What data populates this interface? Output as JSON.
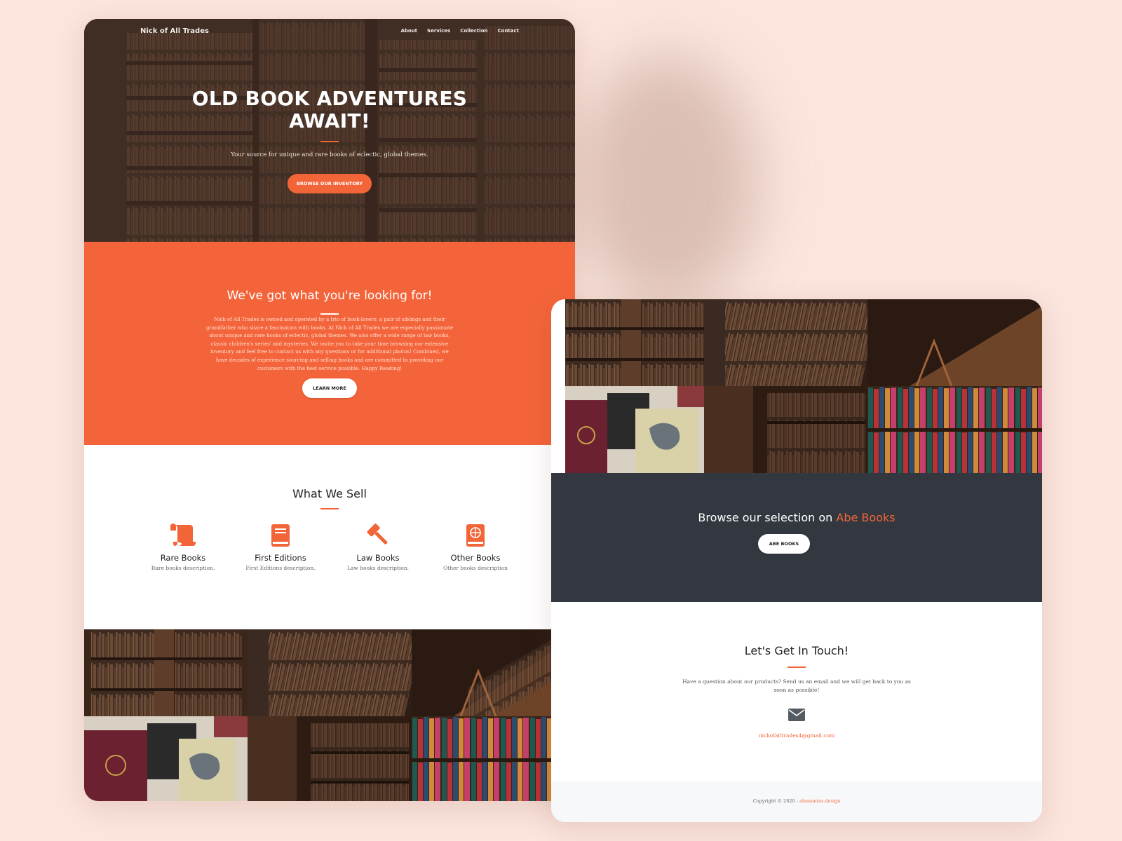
{
  "nav": {
    "brand": "Nick of All Trades",
    "links": [
      "About",
      "Services",
      "Collection",
      "Contact"
    ]
  },
  "hero": {
    "title_line1": "OLD BOOK ADVENTURES",
    "title_line2": "AWAIT!",
    "subtitle": "Your source for unique and rare books of eclectic, global themes.",
    "cta": "BROWSE OUR INVENTORY"
  },
  "about": {
    "heading": "We've got what you're looking for!",
    "body": "Nick of All Trades is owned and operated by a trio of book-lovers: a pair of siblings and their grandfather who share a fascination with books. At Nick of All Trades we are especially passionate about unique and rare books of eclectic, global themes. We also offer a wide range of law books, classic children's series' and mysteries. We invite you to take your time browsing our extensive inventory and feel free to contact us with any questions or for additional photos! Combined, we have decades of experience sourcing and selling books and are committed to providing our customers with the best service possible. Happy Reading!",
    "button": "LEARN MORE"
  },
  "sell": {
    "heading": "What We Sell",
    "items": [
      {
        "title": "Rare Books",
        "desc": "Rare books description.",
        "icon": "scroll-icon"
      },
      {
        "title": "First Editions",
        "desc": "First Editions description.",
        "icon": "book-icon"
      },
      {
        "title": "Law Books",
        "desc": "Law books description.",
        "icon": "gavel-icon"
      },
      {
        "title": "Other Books",
        "desc": "Other books description",
        "icon": "atlas-icon"
      }
    ]
  },
  "browse": {
    "heading_prefix": "Browse our selection on ",
    "heading_accent": "Abe Books",
    "button": "ABE BOOKS"
  },
  "contact": {
    "heading": "Let's Get In Touch!",
    "body": "Have a question about our products? Send us an email and we will get back to you as soon as possible!",
    "email": "nickofalltrades4@gmail.com",
    "icon": "envelope-icon"
  },
  "footer": {
    "copyright": "Copyright © 2020 - ",
    "credit": "alessantos.design"
  },
  "colors": {
    "accent": "#f26538",
    "dark": "#333840",
    "background": "#fbe5dd"
  }
}
